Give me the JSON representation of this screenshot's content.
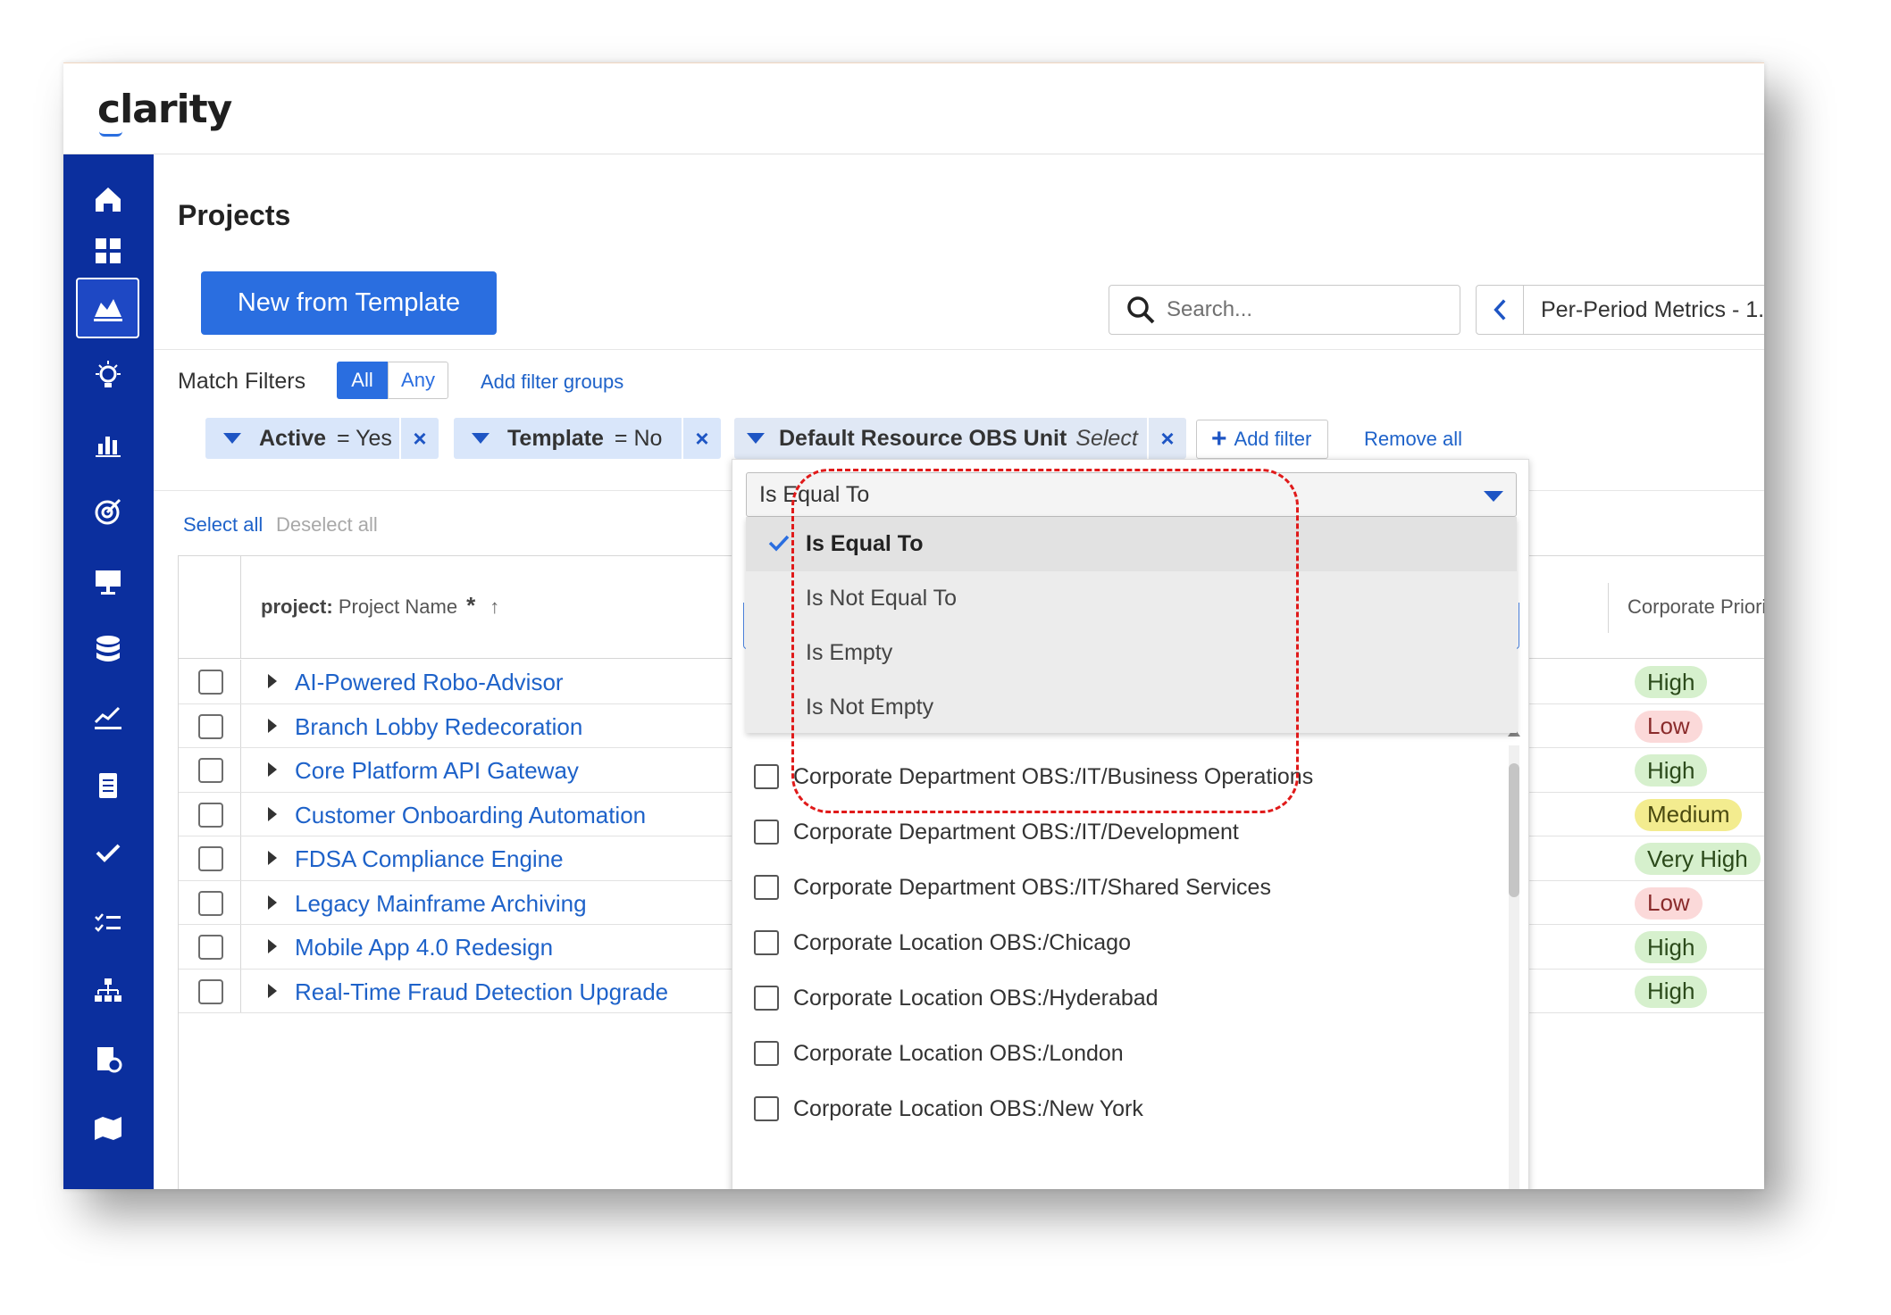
{
  "app": {
    "logo": "clarity"
  },
  "sidebar": {
    "items": [
      {
        "icon": "home-icon",
        "active": false
      },
      {
        "icon": "dashboard-icon",
        "active": false
      },
      {
        "icon": "projects-icon",
        "active": true
      },
      {
        "icon": "idea-icon",
        "active": false
      },
      {
        "icon": "reports-icon",
        "active": false
      },
      {
        "icon": "goals-icon",
        "active": false
      },
      {
        "icon": "presentation-icon",
        "active": false
      },
      {
        "icon": "database-icon",
        "active": false
      },
      {
        "icon": "trend-icon",
        "active": false
      },
      {
        "icon": "clipboard-icon",
        "active": false
      },
      {
        "icon": "checkmark-icon",
        "active": false
      },
      {
        "icon": "task-list-icon",
        "active": false
      },
      {
        "icon": "hierarchy-icon",
        "active": false
      },
      {
        "icon": "timesheet-icon",
        "active": false
      },
      {
        "icon": "map-icon",
        "active": false
      }
    ]
  },
  "page": {
    "title": "Projects"
  },
  "toolbar": {
    "new_from_template": "New from Template",
    "search_placeholder": "Search...",
    "view_name": "Per-Period Metrics - 1."
  },
  "filters": {
    "match_label": "Match Filters",
    "match_all": "All",
    "match_any": "Any",
    "add_filter_groups": "Add filter groups",
    "chips": [
      {
        "name": "Active",
        "value": "= Yes"
      },
      {
        "name": "Template",
        "value": "= No"
      },
      {
        "name": "Default Resource OBS Unit",
        "value": "Select"
      }
    ],
    "remove_icon": "×",
    "add_filter": "Add filter",
    "remove_all": "Remove all"
  },
  "selection": {
    "select_all": "Select all",
    "deselect_all": "Deselect all"
  },
  "grid": {
    "columns": {
      "name_prefix": "project:",
      "name": "Project Name",
      "name_star": "*",
      "name_sort": "↑",
      "priority": "Corporate Priority"
    },
    "rows": [
      {
        "name": "AI-Powered Robo-Advisor",
        "priority": "High",
        "color": "green"
      },
      {
        "name": "Branch Lobby Redecoration",
        "priority": "Low",
        "color": "red"
      },
      {
        "name": "Core Platform API Gateway",
        "priority": "High",
        "color": "green"
      },
      {
        "name": "Customer Onboarding Automation",
        "priority": "Medium",
        "color": "yellow"
      },
      {
        "name": "FDSA Compliance Engine",
        "priority": "Very High",
        "color": "green"
      },
      {
        "name": "Legacy Mainframe Archiving",
        "priority": "Low",
        "color": "red"
      },
      {
        "name": "Mobile App 4.0 Redesign",
        "priority": "High",
        "color": "green"
      },
      {
        "name": "Real-Time Fraud Detection Upgrade",
        "priority": "High",
        "color": "green"
      }
    ]
  },
  "dropdown": {
    "operator_selected": "Is Equal To",
    "operators": [
      "Is Equal To",
      "Is Not Equal To",
      "Is Empty",
      "Is Not Empty"
    ],
    "obs_options": [
      "Corporate Department OBS:/IT/Business Operations",
      "Corporate Department OBS:/IT/Development",
      "Corporate Department OBS:/IT/Shared Services",
      "Corporate Location OBS:/Chicago",
      "Corporate Location OBS:/Hyderabad",
      "Corporate Location OBS:/London",
      "Corporate Location OBS:/New York"
    ]
  },
  "colors": {
    "accent": "#2a6ee0",
    "sidebar": "#0b2f9e",
    "highlight": "#e01a1a"
  }
}
